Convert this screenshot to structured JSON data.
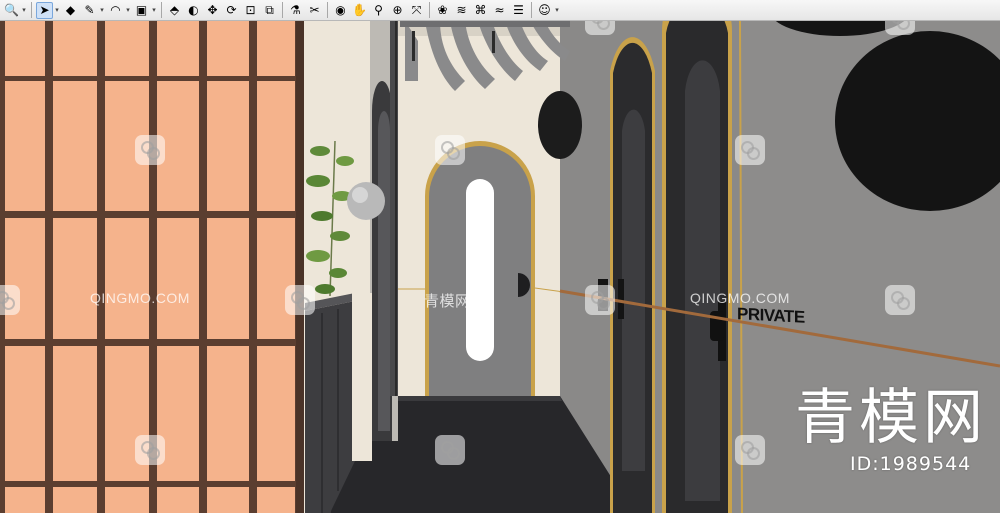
{
  "toolbar": {
    "tools": [
      {
        "icon": "search-icon",
        "glyph": "🔍",
        "active": false,
        "dropdown": true
      },
      {
        "icon": "select-arrow-icon",
        "glyph": "➤",
        "active": true,
        "dropdown": true
      },
      {
        "icon": "eraser-icon",
        "glyph": "◆",
        "active": false,
        "dropdown": false
      },
      {
        "icon": "pencil-icon",
        "glyph": "✎",
        "active": false,
        "dropdown": true
      },
      {
        "icon": "arc-icon",
        "glyph": "◠",
        "active": false,
        "dropdown": true
      },
      {
        "icon": "rectangle-icon",
        "glyph": "▣",
        "active": false,
        "dropdown": true
      },
      {
        "icon": "push-pull-icon",
        "glyph": "⬘",
        "active": false,
        "dropdown": false
      },
      {
        "icon": "follow-me-icon",
        "glyph": "◐",
        "active": false,
        "dropdown": false
      },
      {
        "icon": "move-icon",
        "glyph": "✥",
        "active": false,
        "dropdown": false
      },
      {
        "icon": "rotate-icon",
        "glyph": "⟳",
        "active": false,
        "dropdown": false
      },
      {
        "icon": "scale-icon",
        "glyph": "⊡",
        "active": false,
        "dropdown": false
      },
      {
        "icon": "offset-icon",
        "glyph": "⧉",
        "active": false,
        "dropdown": false
      },
      {
        "icon": "paint-bucket-icon",
        "glyph": "⚗",
        "active": false,
        "dropdown": false
      },
      {
        "icon": "section-plane-icon",
        "glyph": "✂",
        "active": false,
        "dropdown": false
      },
      {
        "icon": "orbit-icon",
        "glyph": "◉",
        "active": false,
        "dropdown": false
      },
      {
        "icon": "pan-icon",
        "glyph": "✋",
        "active": false,
        "dropdown": false
      },
      {
        "icon": "zoom-icon",
        "glyph": "⚲",
        "active": false,
        "dropdown": false
      },
      {
        "icon": "zoom-window-icon",
        "glyph": "⊕",
        "active": false,
        "dropdown": false
      },
      {
        "icon": "zoom-extents-icon",
        "glyph": "⤧",
        "active": false,
        "dropdown": false
      },
      {
        "icon": "sandbox-icon",
        "glyph": "❀",
        "active": false,
        "dropdown": false
      },
      {
        "icon": "terrain-icon",
        "glyph": "≋",
        "active": false,
        "dropdown": false
      },
      {
        "icon": "stamp-icon",
        "glyph": "⌘",
        "active": false,
        "dropdown": false
      },
      {
        "icon": "drape-icon",
        "glyph": "≈",
        "active": false,
        "dropdown": false
      },
      {
        "icon": "smoove-icon",
        "glyph": "☰",
        "active": false,
        "dropdown": false
      },
      {
        "icon": "user-icon",
        "glyph": "☺",
        "active": false,
        "dropdown": true
      }
    ],
    "separators_after": [
      0,
      5,
      11,
      13,
      18,
      23
    ]
  },
  "viewport": {
    "watermark_text": "QINGMO.COM",
    "watermark_cn": "青模网",
    "brand_text": "青模网",
    "brand_id": "ID:1989544",
    "sign_text": "PRIVATE"
  },
  "colors": {
    "peach": "#f5b38c",
    "brown_frame": "#5b3e30",
    "wall_cream": "#ede6d9",
    "wall_grey": "#8b8a89",
    "door_grey": "#7f7f80",
    "floor": "#2a2a2c",
    "gold": "#c9a24a",
    "dark": "#1e1e20"
  }
}
